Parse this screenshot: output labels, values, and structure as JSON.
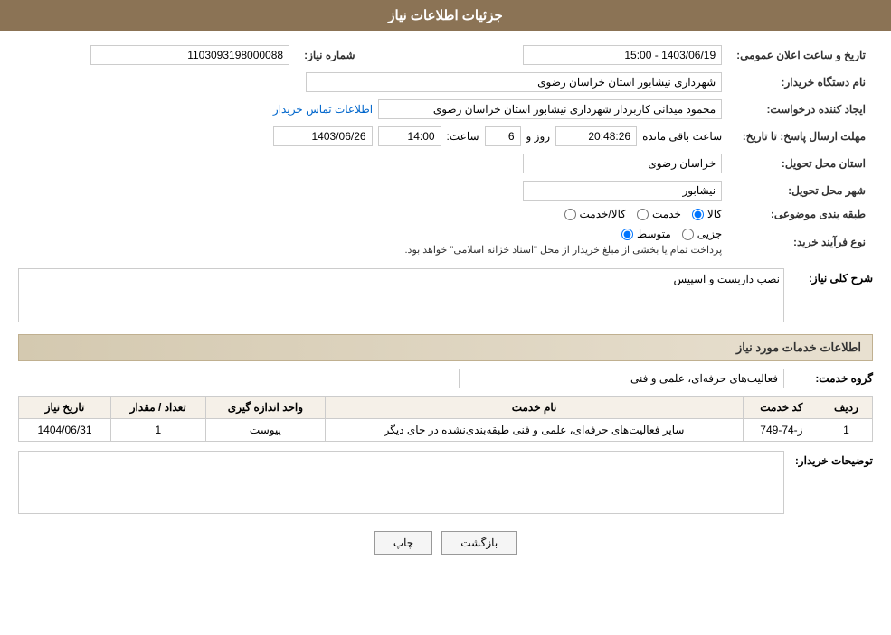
{
  "page": {
    "title": "جزئیات اطلاعات نیاز"
  },
  "header": {
    "label": "شماره نیاز",
    "value": "1103093198000088",
    "public_announce_label": "تاریخ و ساعت اعلان عمومی:",
    "public_announce_value": "1403/06/19 - 15:00"
  },
  "fields": {
    "buyer_org_label": "نام دستگاه خریدار:",
    "buyer_org_value": "شهرداری نیشابور استان خراسان رضوی",
    "creator_label": "ایجاد کننده درخواست:",
    "creator_value": "محمود میدانی کاربردار شهرداری نیشابور استان خراسان رضوی",
    "contact_link": "اطلاعات تماس خریدار",
    "deadline_label": "مهلت ارسال پاسخ: تا تاریخ:",
    "deadline_date": "1403/06/26",
    "deadline_time_label": "ساعت:",
    "deadline_time": "14:00",
    "deadline_days_label": "روز و",
    "deadline_days": "6",
    "remaining_label": "ساعت باقی مانده",
    "remaining_time": "20:48:26",
    "province_label": "استان محل تحویل:",
    "province_value": "خراسان رضوی",
    "city_label": "شهر محل تحویل:",
    "city_value": "نیشابور",
    "category_label": "طبقه بندی موضوعی:",
    "category_options": [
      "کالا",
      "خدمت",
      "کالا/خدمت"
    ],
    "category_selected": "کالا",
    "purchase_type_label": "نوع فرآیند خرید:",
    "purchase_type_options": [
      "جزیی",
      "متوسط"
    ],
    "purchase_type_note": "پرداخت تمام یا بخشی از مبلغ خریدار از محل \"اسناد خزانه اسلامی\" خواهد بود.",
    "description_label": "شرح کلی نیاز:",
    "description_value": "نصب داربست و اسپیس"
  },
  "services_section": {
    "title": "اطلاعات خدمات مورد نیاز",
    "group_label": "گروه خدمت:",
    "group_value": "فعالیت‌های حرفه‌ای، علمی و فنی",
    "table": {
      "headers": [
        "ردیف",
        "کد خدمت",
        "نام خدمت",
        "واحد اندازه گیری",
        "تعداد / مقدار",
        "تاریخ نیاز"
      ],
      "rows": [
        {
          "row_num": "1",
          "code": "ز-74-749",
          "name": "سایر فعالیت‌های حرفه‌ای، علمی و فنی طبقه‌بندی‌نشده در جای دیگر",
          "unit": "پیوست",
          "quantity": "1",
          "date": "1404/06/31"
        }
      ]
    }
  },
  "buyer_notes": {
    "label": "توضیحات خریدار:",
    "value": ""
  },
  "buttons": {
    "print_label": "چاپ",
    "back_label": "بازگشت"
  }
}
